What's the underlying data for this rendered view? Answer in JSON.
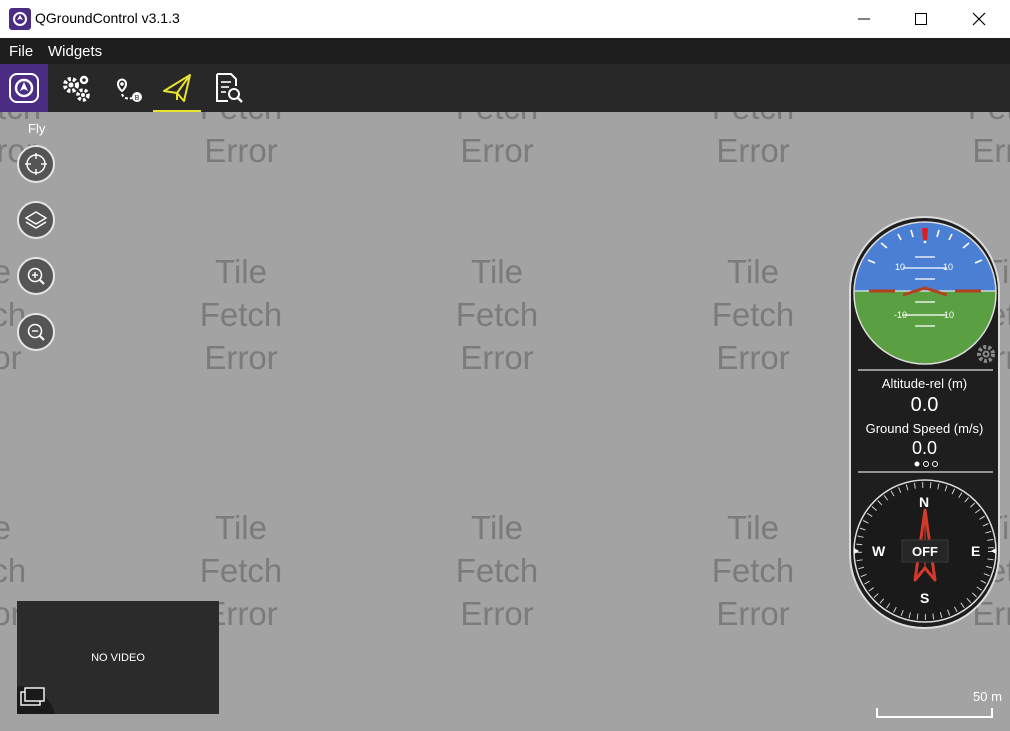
{
  "window": {
    "title": "QGroundControl v3.1.3",
    "minimize": "—",
    "maximize": "☐",
    "close": "✕"
  },
  "menu": [
    "File",
    "Widgets"
  ],
  "toolbar": {
    "items": [
      {
        "name": "qgc-logo",
        "active": false
      },
      {
        "name": "vehicle-setup",
        "active": false
      },
      {
        "name": "plan-view",
        "active": false
      },
      {
        "name": "fly-view",
        "active": true
      },
      {
        "name": "analyze-view",
        "active": false
      }
    ]
  },
  "map": {
    "tile_lines": [
      "Tile",
      "Fetch",
      "Error"
    ],
    "fly_label": "Fly",
    "scale_label": "50 m"
  },
  "video": {
    "label": "NO VIDEO"
  },
  "instruments": {
    "attitude_ticks": [
      "10",
      "10",
      "-10",
      "-10"
    ],
    "altitude_label": "Altitude-rel (m)",
    "altitude_value": "0.0",
    "speed_label": "Ground Speed (m/s)",
    "speed_value": "0.0",
    "compass": {
      "n": "N",
      "s": "S",
      "e": "E",
      "w": "W",
      "center": "OFF"
    }
  },
  "colors": {
    "accent_purple": "#4b2d83",
    "active_underline": "#e8e230",
    "sky": "#4a7fd4",
    "ground": "#5aa042",
    "compass_arrow": "#d23a2a"
  }
}
